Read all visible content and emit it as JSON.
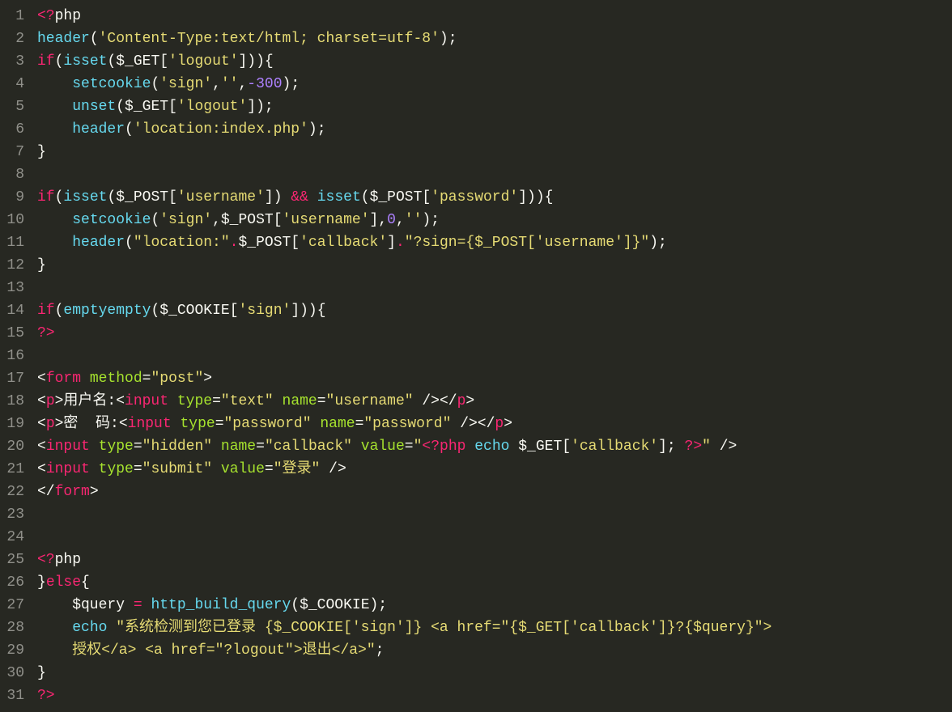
{
  "gutter": {
    "lines": [
      "1",
      "2",
      "3",
      "4",
      "5",
      "6",
      "7",
      "8",
      "9",
      "10",
      "11",
      "12",
      "13",
      "14",
      "15",
      "16",
      "17",
      "18",
      "19",
      "20",
      "21",
      "22",
      "23",
      "24",
      "25",
      "26",
      "27",
      "28",
      "29",
      "30",
      "31"
    ]
  },
  "code": {
    "lines": [
      [
        {
          "t": "<?",
          "c": "keyword"
        },
        {
          "t": "php",
          "c": "default"
        }
      ],
      [
        {
          "t": "header",
          "c": "func"
        },
        {
          "t": "(",
          "c": "default"
        },
        {
          "t": "'Content-Type:text/html; charset=utf-8'",
          "c": "string"
        },
        {
          "t": ");",
          "c": "default"
        }
      ],
      [
        {
          "t": "if",
          "c": "keyword"
        },
        {
          "t": "(",
          "c": "default"
        },
        {
          "t": "isset",
          "c": "func"
        },
        {
          "t": "(",
          "c": "default"
        },
        {
          "t": "$_GET",
          "c": "default"
        },
        {
          "t": "[",
          "c": "default"
        },
        {
          "t": "'logout'",
          "c": "string"
        },
        {
          "t": "])){",
          "c": "default"
        }
      ],
      [
        {
          "t": "    ",
          "c": "default"
        },
        {
          "t": "setcookie",
          "c": "func"
        },
        {
          "t": "(",
          "c": "default"
        },
        {
          "t": "'sign'",
          "c": "string"
        },
        {
          "t": ",",
          "c": "default"
        },
        {
          "t": "''",
          "c": "string"
        },
        {
          "t": ",",
          "c": "default"
        },
        {
          "t": "-300",
          "c": "number"
        },
        {
          "t": ");",
          "c": "default"
        }
      ],
      [
        {
          "t": "    ",
          "c": "default"
        },
        {
          "t": "unset",
          "c": "func"
        },
        {
          "t": "(",
          "c": "default"
        },
        {
          "t": "$_GET",
          "c": "default"
        },
        {
          "t": "[",
          "c": "default"
        },
        {
          "t": "'logout'",
          "c": "string"
        },
        {
          "t": "]);",
          "c": "default"
        }
      ],
      [
        {
          "t": "    ",
          "c": "default"
        },
        {
          "t": "header",
          "c": "func"
        },
        {
          "t": "(",
          "c": "default"
        },
        {
          "t": "'location:index.php'",
          "c": "string"
        },
        {
          "t": ");",
          "c": "default"
        }
      ],
      [
        {
          "t": "}",
          "c": "default"
        }
      ],
      [],
      [
        {
          "t": "if",
          "c": "keyword"
        },
        {
          "t": "(",
          "c": "default"
        },
        {
          "t": "isset",
          "c": "func"
        },
        {
          "t": "(",
          "c": "default"
        },
        {
          "t": "$_POST",
          "c": "default"
        },
        {
          "t": "[",
          "c": "default"
        },
        {
          "t": "'username'",
          "c": "string"
        },
        {
          "t": "]) ",
          "c": "default"
        },
        {
          "t": "&&",
          "c": "keyword"
        },
        {
          "t": " ",
          "c": "default"
        },
        {
          "t": "isset",
          "c": "func"
        },
        {
          "t": "(",
          "c": "default"
        },
        {
          "t": "$_POST",
          "c": "default"
        },
        {
          "t": "[",
          "c": "default"
        },
        {
          "t": "'password'",
          "c": "string"
        },
        {
          "t": "])){",
          "c": "default"
        }
      ],
      [
        {
          "t": "    ",
          "c": "default"
        },
        {
          "t": "setcookie",
          "c": "func"
        },
        {
          "t": "(",
          "c": "default"
        },
        {
          "t": "'sign'",
          "c": "string"
        },
        {
          "t": ",",
          "c": "default"
        },
        {
          "t": "$_POST",
          "c": "default"
        },
        {
          "t": "[",
          "c": "default"
        },
        {
          "t": "'username'",
          "c": "string"
        },
        {
          "t": "],",
          "c": "default"
        },
        {
          "t": "0",
          "c": "number"
        },
        {
          "t": ",",
          "c": "default"
        },
        {
          "t": "''",
          "c": "string"
        },
        {
          "t": ");",
          "c": "default"
        }
      ],
      [
        {
          "t": "    ",
          "c": "default"
        },
        {
          "t": "header",
          "c": "func"
        },
        {
          "t": "(",
          "c": "default"
        },
        {
          "t": "\"location:\"",
          "c": "string"
        },
        {
          "t": ".",
          "c": "keyword"
        },
        {
          "t": "$_POST",
          "c": "default"
        },
        {
          "t": "[",
          "c": "default"
        },
        {
          "t": "'callback'",
          "c": "string"
        },
        {
          "t": "]",
          "c": "default"
        },
        {
          "t": ".",
          "c": "keyword"
        },
        {
          "t": "\"?sign={$_POST['username']}\"",
          "c": "string"
        },
        {
          "t": ");",
          "c": "default"
        }
      ],
      [
        {
          "t": "}",
          "c": "default"
        }
      ],
      [],
      [
        {
          "t": "if",
          "c": "keyword"
        },
        {
          "t": "(",
          "c": "default"
        },
        {
          "t": "emptyempty",
          "c": "func"
        },
        {
          "t": "(",
          "c": "default"
        },
        {
          "t": "$_COOKIE",
          "c": "default"
        },
        {
          "t": "[",
          "c": "default"
        },
        {
          "t": "'sign'",
          "c": "string"
        },
        {
          "t": "])){",
          "c": "default"
        }
      ],
      [
        {
          "t": "?>",
          "c": "keyword"
        }
      ],
      [],
      [
        {
          "t": "<",
          "c": "default"
        },
        {
          "t": "form",
          "c": "tag"
        },
        {
          "t": " ",
          "c": "default"
        },
        {
          "t": "method",
          "c": "attr"
        },
        {
          "t": "=",
          "c": "default"
        },
        {
          "t": "\"post\"",
          "c": "string"
        },
        {
          "t": ">",
          "c": "default"
        }
      ],
      [
        {
          "t": "<",
          "c": "default"
        },
        {
          "t": "p",
          "c": "tag"
        },
        {
          "t": ">用户名:<",
          "c": "default"
        },
        {
          "t": "input",
          "c": "tag"
        },
        {
          "t": " ",
          "c": "default"
        },
        {
          "t": "type",
          "c": "attr"
        },
        {
          "t": "=",
          "c": "default"
        },
        {
          "t": "\"text\"",
          "c": "string"
        },
        {
          "t": " ",
          "c": "default"
        },
        {
          "t": "name",
          "c": "attr"
        },
        {
          "t": "=",
          "c": "default"
        },
        {
          "t": "\"username\"",
          "c": "string"
        },
        {
          "t": " /></",
          "c": "default"
        },
        {
          "t": "p",
          "c": "tag"
        },
        {
          "t": ">",
          "c": "default"
        }
      ],
      [
        {
          "t": "<",
          "c": "default"
        },
        {
          "t": "p",
          "c": "tag"
        },
        {
          "t": ">密  码:<",
          "c": "default"
        },
        {
          "t": "input",
          "c": "tag"
        },
        {
          "t": " ",
          "c": "default"
        },
        {
          "t": "type",
          "c": "attr"
        },
        {
          "t": "=",
          "c": "default"
        },
        {
          "t": "\"password\"",
          "c": "string"
        },
        {
          "t": " ",
          "c": "default"
        },
        {
          "t": "name",
          "c": "attr"
        },
        {
          "t": "=",
          "c": "default"
        },
        {
          "t": "\"password\"",
          "c": "string"
        },
        {
          "t": " /></",
          "c": "default"
        },
        {
          "t": "p",
          "c": "tag"
        },
        {
          "t": ">",
          "c": "default"
        }
      ],
      [
        {
          "t": "<",
          "c": "default"
        },
        {
          "t": "input",
          "c": "tag"
        },
        {
          "t": " ",
          "c": "default"
        },
        {
          "t": "type",
          "c": "attr"
        },
        {
          "t": "=",
          "c": "default"
        },
        {
          "t": "\"hidden\"",
          "c": "string"
        },
        {
          "t": " ",
          "c": "default"
        },
        {
          "t": "name",
          "c": "attr"
        },
        {
          "t": "=",
          "c": "default"
        },
        {
          "t": "\"callback\"",
          "c": "string"
        },
        {
          "t": " ",
          "c": "default"
        },
        {
          "t": "value",
          "c": "attr"
        },
        {
          "t": "=",
          "c": "default"
        },
        {
          "t": "\"",
          "c": "string"
        },
        {
          "t": "<?php ",
          "c": "keyword"
        },
        {
          "t": "echo",
          "c": "echo"
        },
        {
          "t": " $_GET[",
          "c": "default"
        },
        {
          "t": "'callback'",
          "c": "string"
        },
        {
          "t": "]; ",
          "c": "default"
        },
        {
          "t": "?>",
          "c": "keyword"
        },
        {
          "t": "\"",
          "c": "string"
        },
        {
          "t": " />",
          "c": "default"
        }
      ],
      [
        {
          "t": "<",
          "c": "default"
        },
        {
          "t": "input",
          "c": "tag"
        },
        {
          "t": " ",
          "c": "default"
        },
        {
          "t": "type",
          "c": "attr"
        },
        {
          "t": "=",
          "c": "default"
        },
        {
          "t": "\"submit\"",
          "c": "string"
        },
        {
          "t": " ",
          "c": "default"
        },
        {
          "t": "value",
          "c": "attr"
        },
        {
          "t": "=",
          "c": "default"
        },
        {
          "t": "\"登录\"",
          "c": "string"
        },
        {
          "t": " />",
          "c": "default"
        }
      ],
      [
        {
          "t": "</",
          "c": "default"
        },
        {
          "t": "form",
          "c": "tag"
        },
        {
          "t": ">",
          "c": "default"
        }
      ],
      [],
      [],
      [
        {
          "t": "<?",
          "c": "keyword"
        },
        {
          "t": "php",
          "c": "default"
        }
      ],
      [
        {
          "t": "}",
          "c": "default"
        },
        {
          "t": "else",
          "c": "keyword"
        },
        {
          "t": "{",
          "c": "default"
        }
      ],
      [
        {
          "t": "    $query ",
          "c": "default"
        },
        {
          "t": "=",
          "c": "keyword"
        },
        {
          "t": " ",
          "c": "default"
        },
        {
          "t": "http_build_query",
          "c": "func"
        },
        {
          "t": "($_COOKIE);",
          "c": "default"
        }
      ],
      [
        {
          "t": "    ",
          "c": "default"
        },
        {
          "t": "echo",
          "c": "echo"
        },
        {
          "t": " ",
          "c": "default"
        },
        {
          "t": "\"系统检测到您已登录 {$_COOKIE['sign']} <a href=\"{$_GET['callback']}?{$query}\">",
          "c": "string"
        }
      ],
      [
        {
          "t": "    授权</a> <a href=\"?logout\">退出</a>\"",
          "c": "string"
        },
        {
          "t": ";",
          "c": "default"
        }
      ],
      [
        {
          "t": "}",
          "c": "default"
        }
      ],
      [
        {
          "t": "?>",
          "c": "keyword"
        }
      ]
    ]
  }
}
